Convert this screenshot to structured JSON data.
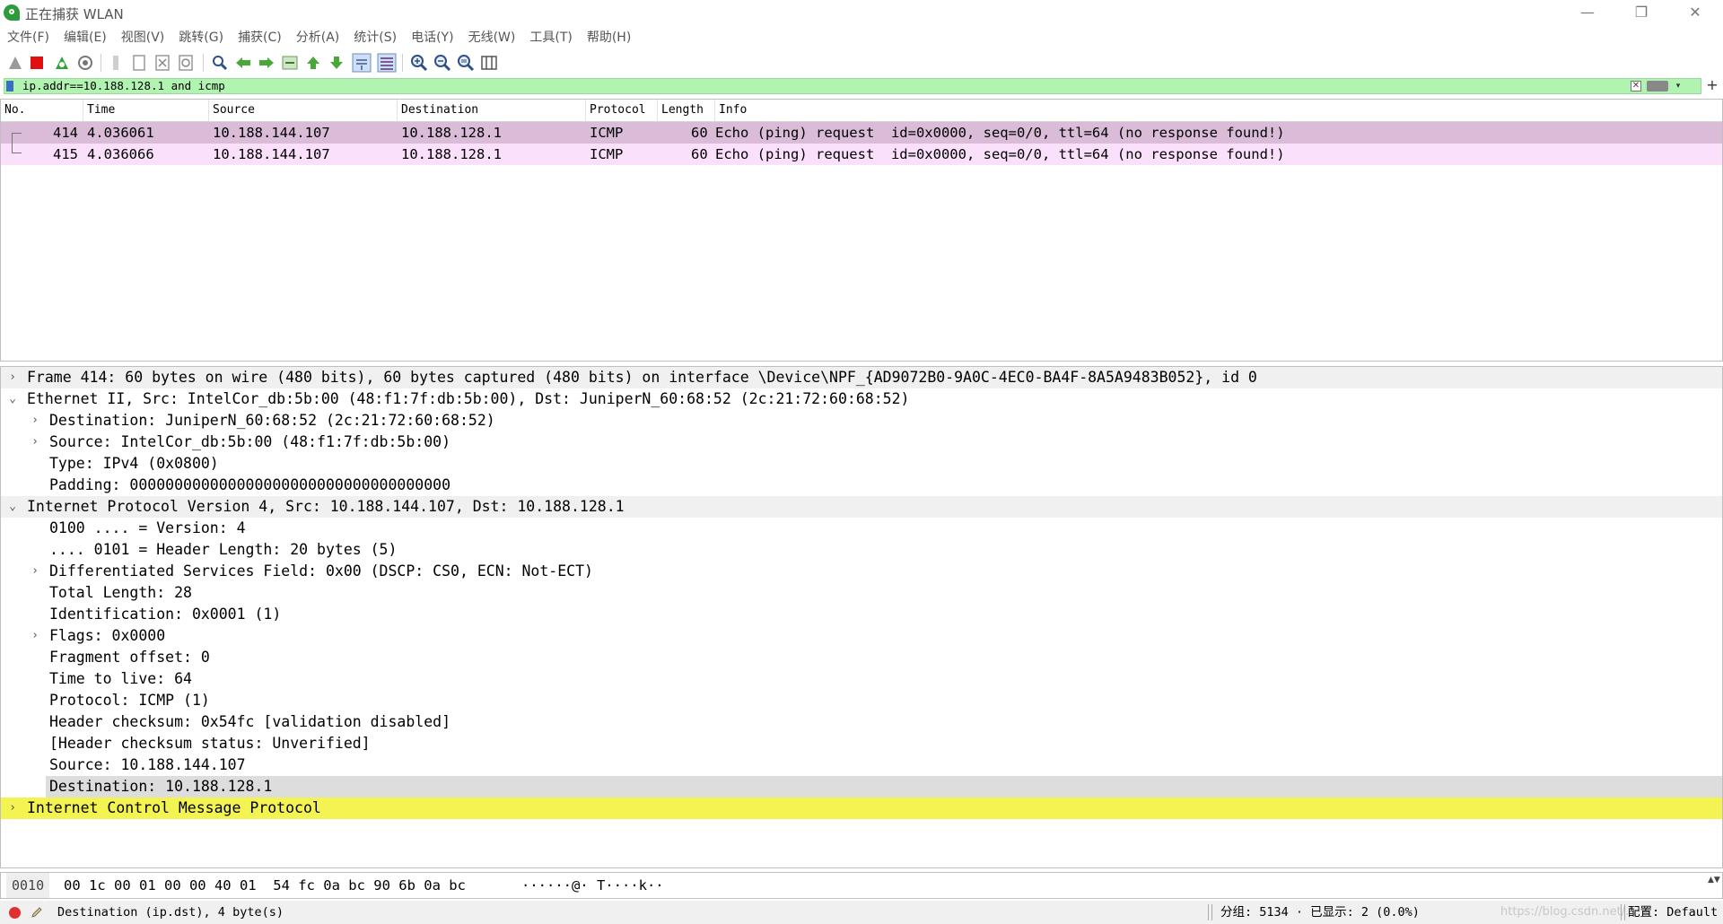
{
  "window": {
    "title": "正在捕获 WLAN",
    "minimize": "—",
    "restore": "❐",
    "close": "✕"
  },
  "menu": [
    "文件(F)",
    "编辑(E)",
    "视图(V)",
    "跳转(G)",
    "捕获(C)",
    "分析(A)",
    "统计(S)",
    "电话(Y)",
    "无线(W)",
    "工具(T)",
    "帮助(H)"
  ],
  "filter": {
    "value": "ip.addr==10.188.128.1 and icmp",
    "clear_label": "✕",
    "dropdown_label": "▾",
    "add_label": "+"
  },
  "packet_list": {
    "columns": [
      "No.",
      "Time",
      "Source",
      "Destination",
      "Protocol",
      "Length",
      "Info"
    ],
    "rows": [
      {
        "no": "414",
        "time": "4.036061",
        "source": "10.188.144.107",
        "destination": "10.188.128.1",
        "protocol": "ICMP",
        "length": "60",
        "info": "Echo (ping) request  id=0x0000, seq=0/0, ttl=64 (no response found!)"
      },
      {
        "no": "415",
        "time": "4.036066",
        "source": "10.188.144.107",
        "destination": "10.188.128.1",
        "protocol": "ICMP",
        "length": "60",
        "info": "Echo (ping) request  id=0x0000, seq=0/0, ttl=64 (no response found!)"
      }
    ]
  },
  "details": {
    "rows": [
      {
        "text": "Frame 414: 60 bytes on wire (480 bits), 60 bytes captured (480 bits) on interface \\Device\\NPF_{AD9072B0-9A0C-4EC0-BA4F-8A5A9483B052}, id 0",
        "arrow": "›"
      },
      {
        "text": "Ethernet II, Src: IntelCor_db:5b:00 (48:f1:7f:db:5b:00), Dst: JuniperN_60:68:52 (2c:21:72:60:68:52)",
        "arrow": "⌄"
      },
      {
        "text": "Destination: JuniperN_60:68:52 (2c:21:72:60:68:52)",
        "arrow": "›"
      },
      {
        "text": "Source: IntelCor_db:5b:00 (48:f1:7f:db:5b:00)",
        "arrow": "›"
      },
      {
        "text": "Type: IPv4 (0x0800)",
        "arrow": ""
      },
      {
        "text": "Padding: 000000000000000000000000000000000000",
        "arrow": ""
      },
      {
        "text": "Internet Protocol Version 4, Src: 10.188.144.107, Dst: 10.188.128.1",
        "arrow": "⌄"
      },
      {
        "text": "0100 .... = Version: 4",
        "arrow": ""
      },
      {
        "text": ".... 0101 = Header Length: 20 bytes (5)",
        "arrow": ""
      },
      {
        "text": "Differentiated Services Field: 0x00 (DSCP: CS0, ECN: Not-ECT)",
        "arrow": "›"
      },
      {
        "text": "Total Length: 28",
        "arrow": ""
      },
      {
        "text": "Identification: 0x0001 (1)",
        "arrow": ""
      },
      {
        "text": "Flags: 0x0000",
        "arrow": "›"
      },
      {
        "text": "Fragment offset: 0",
        "arrow": ""
      },
      {
        "text": "Time to live: 64",
        "arrow": ""
      },
      {
        "text": "Protocol: ICMP (1)",
        "arrow": ""
      },
      {
        "text": "Header checksum: 0x54fc [validation disabled]",
        "arrow": ""
      },
      {
        "text": "[Header checksum status: Unverified]",
        "arrow": ""
      },
      {
        "text": "Source: 10.188.144.107",
        "arrow": ""
      },
      {
        "text": "Destination: 10.188.128.1",
        "arrow": ""
      },
      {
        "text": "Internet Control Message Protocol",
        "arrow": "›"
      }
    ]
  },
  "bytes": {
    "offset": "0010",
    "hex": "00 1c 00 01 00 00 40 01  54 fc 0a bc 90 6b 0a bc",
    "ascii": "······@· T····k··",
    "scroll": "▲▼"
  },
  "status": {
    "field": "Destination (ip.dst), 4 byte(s)",
    "packets": "分组: 5134 · 已显示: 2 (0.0%)",
    "profile": "配置: Default",
    "watermark": "https://blog.csdn.net/..."
  },
  "colors": {
    "filter_valid": "#b1f3b1",
    "row_selected": "#dabcd9",
    "row_icmp": "#fbe0fb",
    "detail_highlight": "#f3f352",
    "detail_selected": "#dddddd"
  }
}
